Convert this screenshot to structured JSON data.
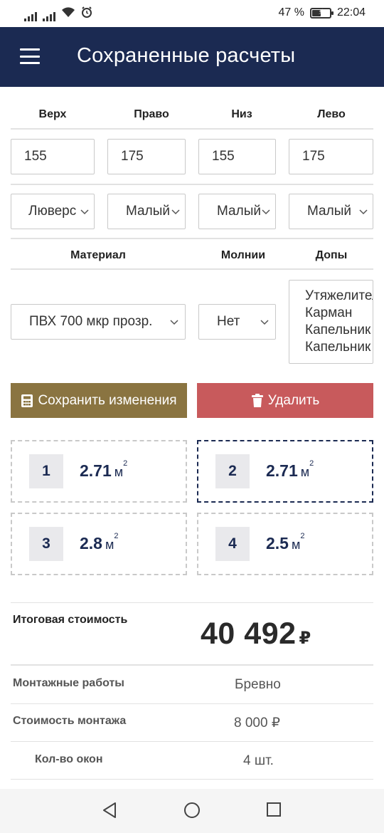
{
  "status_bar": {
    "battery_percent": "47 %",
    "time": "22:04"
  },
  "header": {
    "title": "Сохраненные расчеты"
  },
  "sides": {
    "labels": [
      "Верх",
      "Право",
      "Низ",
      "Лево"
    ],
    "values": [
      "155",
      "175",
      "155",
      "175"
    ],
    "fastenings": [
      "Люверс",
      "Малый",
      "Малый",
      "Малый"
    ]
  },
  "options": {
    "labels": {
      "material": "Материал",
      "zippers": "Молнии",
      "extras": "Допы"
    },
    "material_value": "ПВХ 700 мкр прозр.",
    "zippers_value": "Нет",
    "extras_items": [
      "Утяжелитель",
      "Карман",
      "Капельник",
      "Капельник"
    ]
  },
  "actions": {
    "save_label": "Сохранить изменения",
    "delete_label": "Удалить"
  },
  "windows": [
    {
      "number": "1",
      "area": "2.71",
      "unit": "м",
      "power": "2"
    },
    {
      "number": "2",
      "area": "2.71",
      "unit": "м",
      "power": "2"
    },
    {
      "number": "3",
      "area": "2.8",
      "unit": "м",
      "power": "2"
    },
    {
      "number": "4",
      "area": "2.5",
      "unit": "м",
      "power": "2"
    }
  ],
  "summary": {
    "total_label": "Итоговая стоимость",
    "total_value": "40 492",
    "currency": "₽",
    "rows": [
      {
        "label": "Монтажные работы",
        "value": "Бревно"
      },
      {
        "label": "Стоимость монтажа",
        "value": "8 000 ₽"
      },
      {
        "label": "Кол-во окон",
        "value": "4 шт."
      }
    ]
  },
  "colors": {
    "header_bg": "#1b2a52",
    "save_button": "#8a7441",
    "delete_button": "#c85a5c",
    "accent_text": "#1b2a52"
  }
}
